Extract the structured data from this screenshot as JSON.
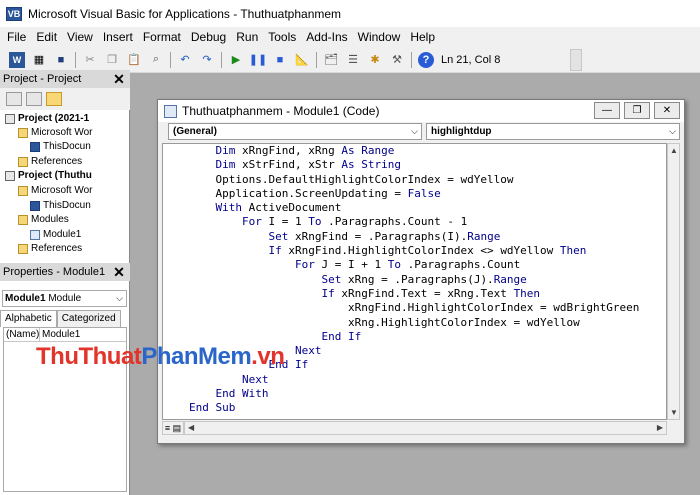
{
  "window": {
    "title": "Microsoft Visual Basic for Applications - Thuthuatphanmem"
  },
  "menu": [
    "File",
    "Edit",
    "View",
    "Insert",
    "Format",
    "Debug",
    "Run",
    "Tools",
    "Add-Ins",
    "Window",
    "Help"
  ],
  "toolbar": {
    "position": "Ln 21, Col 8",
    "icons": [
      "word-icon",
      "insert-module-icon",
      "save-icon",
      "cut-icon",
      "copy-icon",
      "paste-icon",
      "find-icon",
      "undo-icon",
      "redo-icon",
      "run-icon",
      "break-icon",
      "reset-icon",
      "design-mode-icon",
      "project-explorer-icon",
      "properties-icon",
      "object-browser-icon",
      "toolbox-icon",
      "help-icon"
    ]
  },
  "project_pane": {
    "title": "Project - Project",
    "tree": [
      {
        "label": "Project (2021-1",
        "bold": true,
        "indent": 0,
        "icon": "project-icon"
      },
      {
        "label": "Microsoft Wor",
        "bold": false,
        "indent": 1,
        "icon": "folder-icon"
      },
      {
        "label": "ThisDocun",
        "bold": false,
        "indent": 2,
        "icon": "word-doc-icon"
      },
      {
        "label": "References",
        "bold": false,
        "indent": 1,
        "icon": "folder-icon"
      },
      {
        "label": "Project (Thuthu",
        "bold": true,
        "indent": 0,
        "icon": "project-icon"
      },
      {
        "label": "Microsoft Wor",
        "bold": false,
        "indent": 1,
        "icon": "folder-icon"
      },
      {
        "label": "ThisDocun",
        "bold": false,
        "indent": 2,
        "icon": "word-doc-icon"
      },
      {
        "label": "Modules",
        "bold": false,
        "indent": 1,
        "icon": "folder-icon"
      },
      {
        "label": "Module1",
        "bold": false,
        "indent": 2,
        "icon": "module-icon"
      },
      {
        "label": "References",
        "bold": false,
        "indent": 1,
        "icon": "folder-icon"
      }
    ]
  },
  "properties_pane": {
    "title": "Properties - Module1",
    "object_name": "Module1",
    "object_type": "Module",
    "tabs": [
      "Alphabetic",
      "Categorized"
    ],
    "rows": [
      {
        "name": "(Name)",
        "value": "Module1"
      }
    ]
  },
  "code_window": {
    "title": "Thuthuatphanmem - Module1 (Code)",
    "object_combo": "(General)",
    "proc_combo": "highlightdup",
    "lines": [
      "    Dim xRngFind, xRng As Range",
      "    Dim xStrFind, xStr As String",
      "    Options.DefaultHighlightColorIndex = wdYellow",
      "    Application.ScreenUpdating = False",
      "    With ActiveDocument",
      "        For I = 1 To .Paragraphs.Count - 1",
      "            Set xRngFind = .Paragraphs(I).Range",
      "            If xRngFind.HighlightColorIndex <> wdYellow Then",
      "                For J = I + 1 To .Paragraphs.Count",
      "                    Set xRng = .Paragraphs(J).Range",
      "                    If xRngFind.Text = xRng.Text Then",
      "                        xRngFind.HighlightColorIndex = wdBrightGreen",
      "                        xRng.HighlightColorIndex = wdYellow",
      "                    End If",
      "                Next",
      "            End If",
      "        Next",
      "    End With",
      "End Sub"
    ]
  },
  "watermark": {
    "part1": "ThuThuat",
    "part2": "PhanMem",
    "part3": ".vn"
  },
  "colors": {
    "keyword": "#00008b",
    "watermark_red": "#e2342a",
    "watermark_blue": "#2a66c9",
    "mdi_bg": "#ababab"
  }
}
